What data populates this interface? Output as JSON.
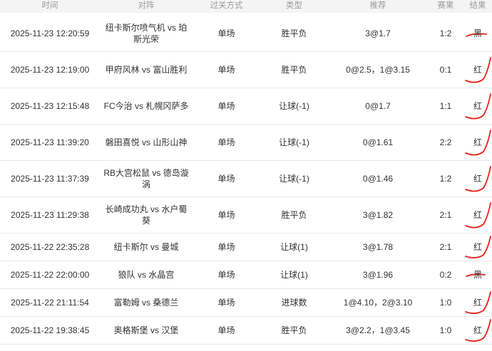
{
  "headers": {
    "time": "时间",
    "match": "对阵",
    "mode": "过关方式",
    "type": "类型",
    "recommend": "推荐",
    "score": "赛果",
    "result": "结果"
  },
  "rows": [
    {
      "time": "2025-11-23 12:20:59",
      "match": "纽卡斯尔喷气机 vs 珀斯光荣",
      "mode": "单场",
      "type": "胜平负",
      "recommend": "3@1.7",
      "score": "1:2",
      "result": "黑"
    },
    {
      "time": "2025-11-23 12:19:00",
      "match": "甲府风林 vs 富山胜利",
      "mode": "单场",
      "type": "胜平负",
      "recommend": "0@2.5，1@3.15",
      "score": "0:1",
      "result": "红"
    },
    {
      "time": "2025-11-23 12:15:48",
      "match": "FC今治 vs 札幌冈萨多",
      "mode": "单场",
      "type": "让球(-1)",
      "recommend": "0@1.7",
      "score": "1:1",
      "result": "红"
    },
    {
      "time": "2025-11-23 11:39:20",
      "match": "磐田喜悦 vs 山形山神",
      "mode": "单场",
      "type": "让球(-1)",
      "recommend": "0@1.61",
      "score": "2:2",
      "result": "红"
    },
    {
      "time": "2025-11-23 11:37:39",
      "match": "RB大宫松鼠 vs 德岛漩涡",
      "mode": "单场",
      "type": "让球(-1)",
      "recommend": "0@1.46",
      "score": "1:2",
      "result": "红"
    },
    {
      "time": "2025-11-23 11:29:38",
      "match": "长崎成功丸 vs 水户蜀葵",
      "mode": "单场",
      "type": "胜平负",
      "recommend": "3@1.82",
      "score": "2:1",
      "result": "红"
    },
    {
      "time": "2025-11-22 22:35:28",
      "match": "纽卡斯尔 vs 曼城",
      "mode": "单场",
      "type": "让球(1)",
      "recommend": "3@1.78",
      "score": "2:1",
      "result": "红"
    },
    {
      "time": "2025-11-22 22:00:00",
      "match": "狼队 vs 水晶宫",
      "mode": "单场",
      "type": "让球(1)",
      "recommend": "3@1.96",
      "score": "0:2",
      "result": "黑"
    },
    {
      "time": "2025-11-22 21:11:54",
      "match": "富勒姆 vs 桑德兰",
      "mode": "单场",
      "type": "进球数",
      "recommend": "1@4.10，2@3.10",
      "score": "1:0",
      "result": "红"
    },
    {
      "time": "2025-11-22 19:38:45",
      "match": "奥格斯堡 vs 汉堡",
      "mode": "单场",
      "type": "胜平负",
      "recommend": "3@2.2，1@3.45",
      "score": "1:0",
      "result": "红"
    }
  ],
  "colors": {
    "red_result": "#e8221b",
    "header_bg": "#f4f4f4",
    "header_text": "#9a9a9a",
    "border": "#e8e8e8"
  }
}
